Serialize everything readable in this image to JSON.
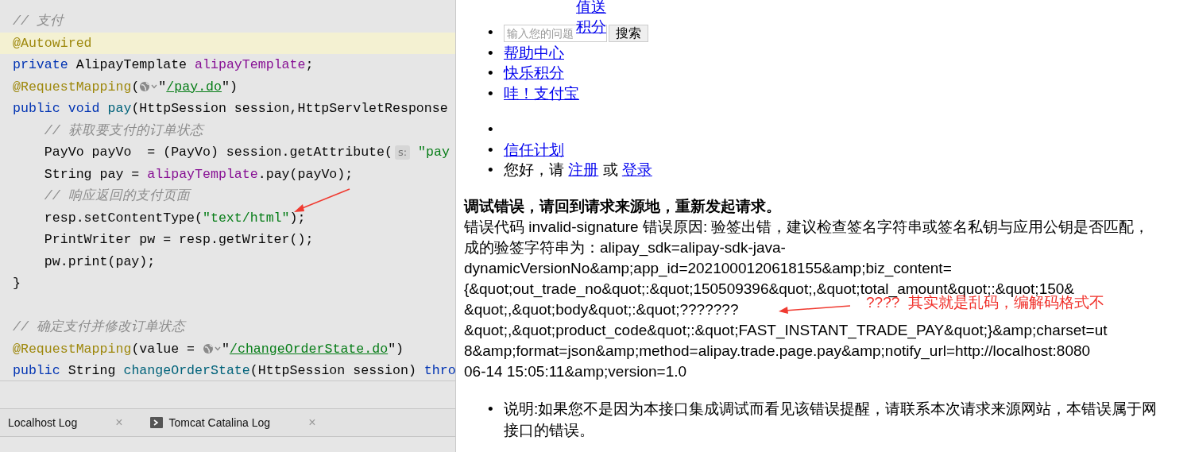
{
  "editor": {
    "lines": [
      {
        "current": false,
        "tokens": [
          {
            "kind": "comment",
            "text": "// 支付"
          }
        ]
      },
      {
        "current": true,
        "tokens": [
          {
            "kind": "annotation",
            "text": "@Autowired"
          }
        ]
      },
      {
        "current": false,
        "tokens": [
          {
            "kind": "keyword",
            "text": "private "
          },
          {
            "kind": "plain",
            "text": "AlipayTemplate "
          },
          {
            "kind": "field",
            "text": "alipayTemplate"
          },
          {
            "kind": "plain",
            "text": ";"
          }
        ]
      },
      {
        "current": false,
        "tokens": [
          {
            "kind": "annotation",
            "text": "@RequestMapping"
          },
          {
            "kind": "plain",
            "text": "("
          },
          {
            "kind": "globe"
          },
          {
            "kind": "plain",
            "text": "\""
          },
          {
            "kind": "link",
            "text": "/pay.do"
          },
          {
            "kind": "plain",
            "text": "\")"
          }
        ]
      },
      {
        "current": false,
        "tokens": [
          {
            "kind": "keyword",
            "text": "public void "
          },
          {
            "kind": "method",
            "text": "pay"
          },
          {
            "kind": "plain",
            "text": "(HttpSession session,HttpServletResponse"
          }
        ]
      },
      {
        "current": false,
        "tokens": [
          {
            "kind": "comment",
            "text": "    // 获取要支付的订单状态"
          }
        ]
      },
      {
        "current": false,
        "tokens": [
          {
            "kind": "plain",
            "text": "    PayVo payVo  = (PayVo) session.getAttribute("
          },
          {
            "kind": "hint",
            "text": "s:"
          },
          {
            "kind": "string",
            "text": " \"pay"
          }
        ]
      },
      {
        "current": false,
        "tokens": [
          {
            "kind": "plain",
            "text": "    String pay = "
          },
          {
            "kind": "field",
            "text": "alipayTemplate"
          },
          {
            "kind": "plain",
            "text": ".pay(payVo);"
          }
        ]
      },
      {
        "current": false,
        "tokens": [
          {
            "kind": "comment",
            "text": "    // 响应返回的支付页面"
          }
        ]
      },
      {
        "current": false,
        "tokens": [
          {
            "kind": "plain",
            "text": "    resp.setContentType("
          },
          {
            "kind": "string",
            "text": "\"text/html\""
          },
          {
            "kind": "plain",
            "text": ");"
          }
        ]
      },
      {
        "current": false,
        "tokens": [
          {
            "kind": "plain",
            "text": "    PrintWriter pw = resp.getWriter();"
          }
        ]
      },
      {
        "current": false,
        "tokens": [
          {
            "kind": "plain",
            "text": "    pw.print(pay);"
          }
        ]
      },
      {
        "current": false,
        "tokens": [
          {
            "kind": "plain",
            "text": "}"
          }
        ]
      },
      {
        "current": false
      },
      {
        "current": false,
        "tokens": [
          {
            "kind": "comment",
            "text": "// 确定支付并修改订单状态"
          }
        ]
      },
      {
        "current": false,
        "tokens": [
          {
            "kind": "annotation",
            "text": "@RequestMapping"
          },
          {
            "kind": "plain",
            "text": "(value = "
          },
          {
            "kind": "globe"
          },
          {
            "kind": "plain",
            "text": "\""
          },
          {
            "kind": "link",
            "text": "/changeOrderState.do"
          },
          {
            "kind": "plain",
            "text": "\")"
          }
        ]
      },
      {
        "current": false,
        "tokens": [
          {
            "kind": "keyword",
            "text": "public "
          },
          {
            "kind": "plain",
            "text": "String "
          },
          {
            "kind": "method",
            "text": "changeOrderState"
          },
          {
            "kind": "plain",
            "text": "(HttpSession session) "
          },
          {
            "kind": "keyword",
            "text": "thro"
          }
        ]
      }
    ]
  },
  "tool_tabs": [
    {
      "label": "Localhost Log",
      "icon": false,
      "close": "×"
    },
    {
      "label": "Tomcat Catalina Log",
      "icon": true,
      "close": "×"
    }
  ],
  "browser": {
    "floating_link": "值送积分",
    "nav": [
      {
        "kind": "search",
        "bullet": "•",
        "placeholder": "输入您的问题",
        "button": "搜索"
      },
      {
        "kind": "link",
        "bullet": "•",
        "text": "帮助中心"
      },
      {
        "kind": "link",
        "bullet": "•",
        "text": "快乐积分"
      },
      {
        "kind": "link",
        "bullet": "•",
        "text": "哇！支付宝"
      },
      {
        "kind": "empty",
        "bullet": "•"
      },
      {
        "kind": "link",
        "bullet": "•",
        "text": "信任计划"
      },
      {
        "kind": "greeting",
        "bullet": "•",
        "parts": [
          {
            "kind": "text",
            "text": "您好，请 "
          },
          {
            "kind": "link",
            "text": "注册"
          },
          {
            "kind": "text",
            "text": " 或 "
          },
          {
            "kind": "link",
            "text": "登录"
          }
        ]
      }
    ],
    "error_title": "调试错误，请回到请求来源地，重新发起请求。",
    "error_lines": [
      "错误代码 invalid-signature 错误原因: 验签出错，建议检查签名字符串或签名私钥与应用公钥是否匹配，",
      "成的验签字符串为：alipay_sdk=alipay-sdk-java-",
      "dynamicVersionNo&amp;app_id=2021000120618155&amp;biz_content=",
      "{&quot;out_trade_no&quot;:&quot;150509396&quot;,&quot;total_amount&quot;:&quot;150&",
      "&quot;,&quot;body&quot;:&quot;???????",
      "&quot;,&quot;product_code&quot;:&quot;FAST_INSTANT_TRADE_PAY&quot;}&amp;charset=ut",
      "8&amp;format=json&amp;method=alipay.trade.page.pay&amp;notify_url=http://localhost:8080",
      "06-14 15:05:11&amp;version=1.0"
    ],
    "note_bullet": "•",
    "note_lines": [
      "说明:如果您不是因为本接口集成调试而看见该错误提醒，请联系本次请求来源网站，本错误属于网",
      "接口的错误。"
    ]
  },
  "annotation_note": "????  其实就是乱码，编解码格式不"
}
